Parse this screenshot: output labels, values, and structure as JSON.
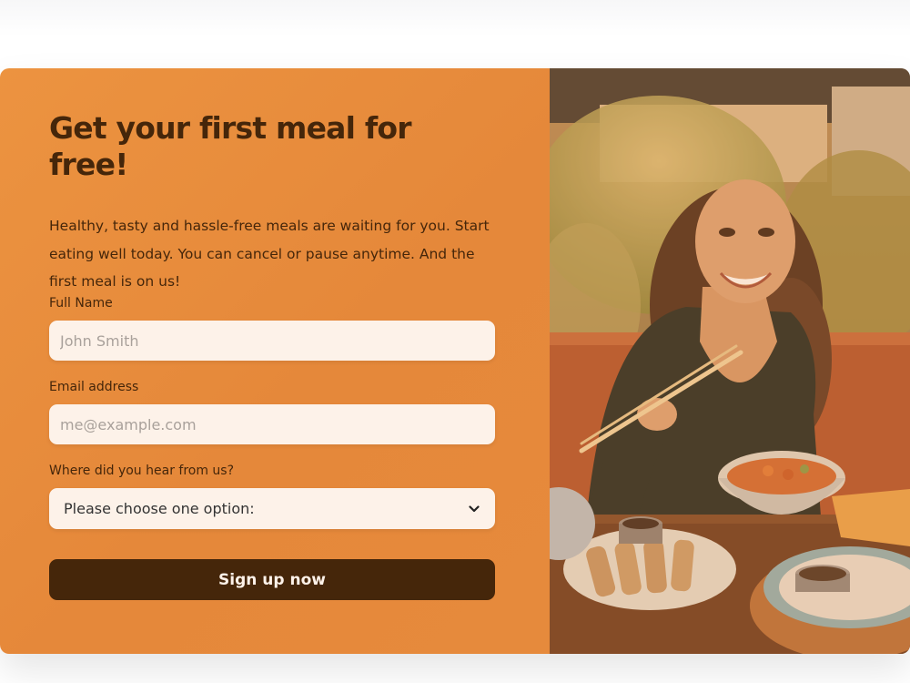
{
  "cta": {
    "heading": "Get your first meal for free!",
    "paragraph": "Healthy, tasty and hassle-free meals are waiting for you. Start eating well today. You can cancel or pause anytime. And the first meal is on us!"
  },
  "form": {
    "full_name": {
      "label": "Full Name",
      "placeholder": "John Smith"
    },
    "email": {
      "label": "Email address",
      "placeholder": "me@example.com"
    },
    "source": {
      "label": "Where did you hear from us?",
      "selected": "Please choose one option:"
    },
    "submit_label": "Sign up now"
  },
  "icons": {
    "select_arrow": "chevron-down-icon"
  },
  "colors": {
    "panel_orange": "#e68a3c",
    "text_dark_brown": "#45260a",
    "input_background": "#fdf2e9",
    "button_background": "#45260a"
  }
}
